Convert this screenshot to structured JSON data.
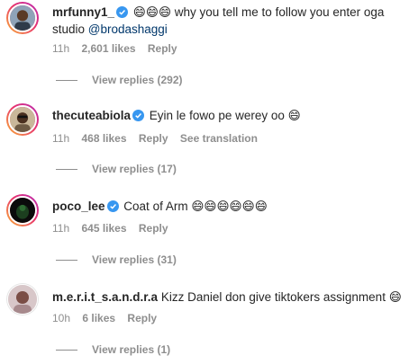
{
  "comments": [
    {
      "username": "mrfunny1_",
      "verified": true,
      "text": "😄😄😄 why you tell me to follow you enter oga",
      "text_line2_pre": "studio ",
      "mention": "@brodashaggi",
      "time": "11h",
      "likes": "2,601 likes",
      "reply": "Reply",
      "view_replies": "View replies (292)"
    },
    {
      "username": "thecuteabiola",
      "verified": true,
      "text": "Eyin le fowo pe werey oo 😄",
      "time": "11h",
      "likes": "468 likes",
      "reply": "Reply",
      "translate": "See translation",
      "view_replies": "View replies (17)"
    },
    {
      "username": "poco_lee",
      "verified": true,
      "text": "Coat of Arm 😄😄😄😄😄😄",
      "time": "11h",
      "likes": "645 likes",
      "reply": "Reply",
      "view_replies": "View replies (31)"
    },
    {
      "username": "m.e.r.i.t_s.a.n.d.r.a",
      "verified": false,
      "text": "Kizz Daniel don give tiktokers assignment 😄",
      "time": "10h",
      "likes": "6 likes",
      "reply": "Reply",
      "view_replies": "View replies (1)"
    }
  ],
  "colors": {
    "username": "#262626",
    "meta": "#8e8e8e",
    "mention": "#00376b",
    "verified": "#3897f0"
  },
  "icons": [
    "verified-badge-icon"
  ]
}
